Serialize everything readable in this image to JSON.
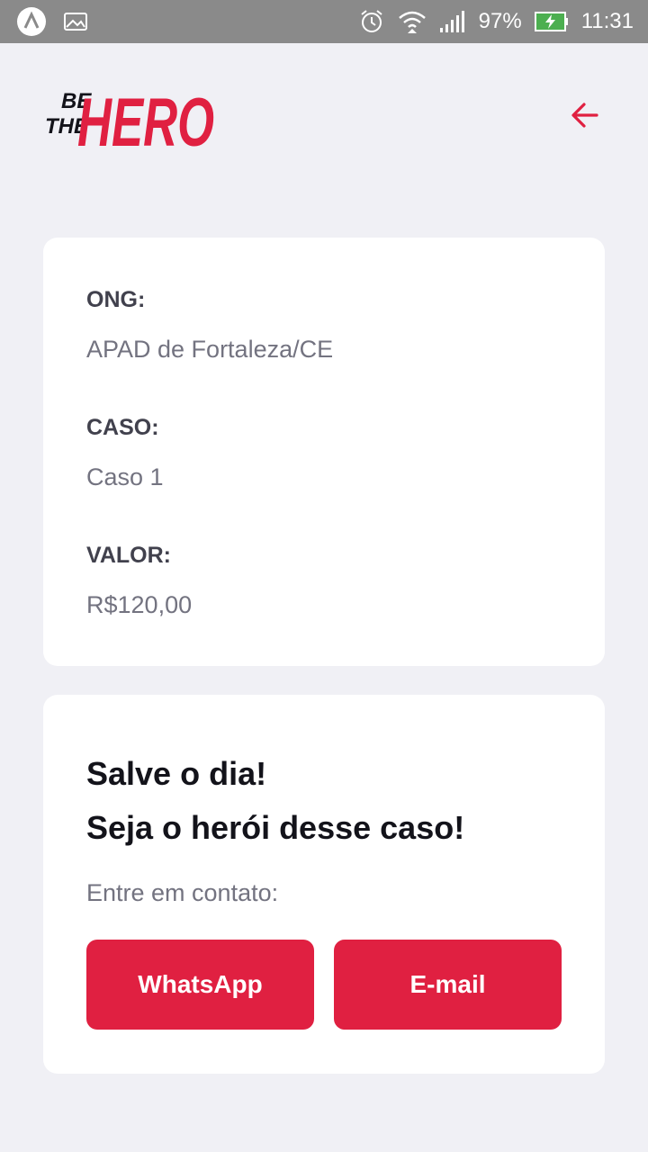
{
  "statusbar": {
    "battery": "97%",
    "time": "11:31",
    "icons": [
      "app-badge-icon",
      "image-icon",
      "alarm-icon",
      "wifi-icon",
      "signal-icon",
      "battery-charging-icon"
    ]
  },
  "header": {
    "logo_text_top": "BE",
    "logo_text_mid": "THE",
    "logo_text_big": "HERO",
    "back_icon": "arrow-left-icon"
  },
  "incident": {
    "ong_label": "ONG:",
    "ong_value": "APAD de Fortaleza/CE",
    "case_label": "CASO:",
    "case_value": "Caso 1",
    "value_label": "VALOR:",
    "value_value": "R$120,00"
  },
  "contact": {
    "title_line1": "Salve o dia!",
    "title_line2": "Seja o herói desse caso!",
    "description": "Entre em contato:",
    "whatsapp_label": "WhatsApp",
    "email_label": "E-mail"
  },
  "colors": {
    "brand": "#e02041",
    "background": "#f0f0f5",
    "card": "#ffffff",
    "label": "#41414d",
    "value": "#737380",
    "title": "#13131a",
    "statusbar": "#8a8a8a"
  }
}
